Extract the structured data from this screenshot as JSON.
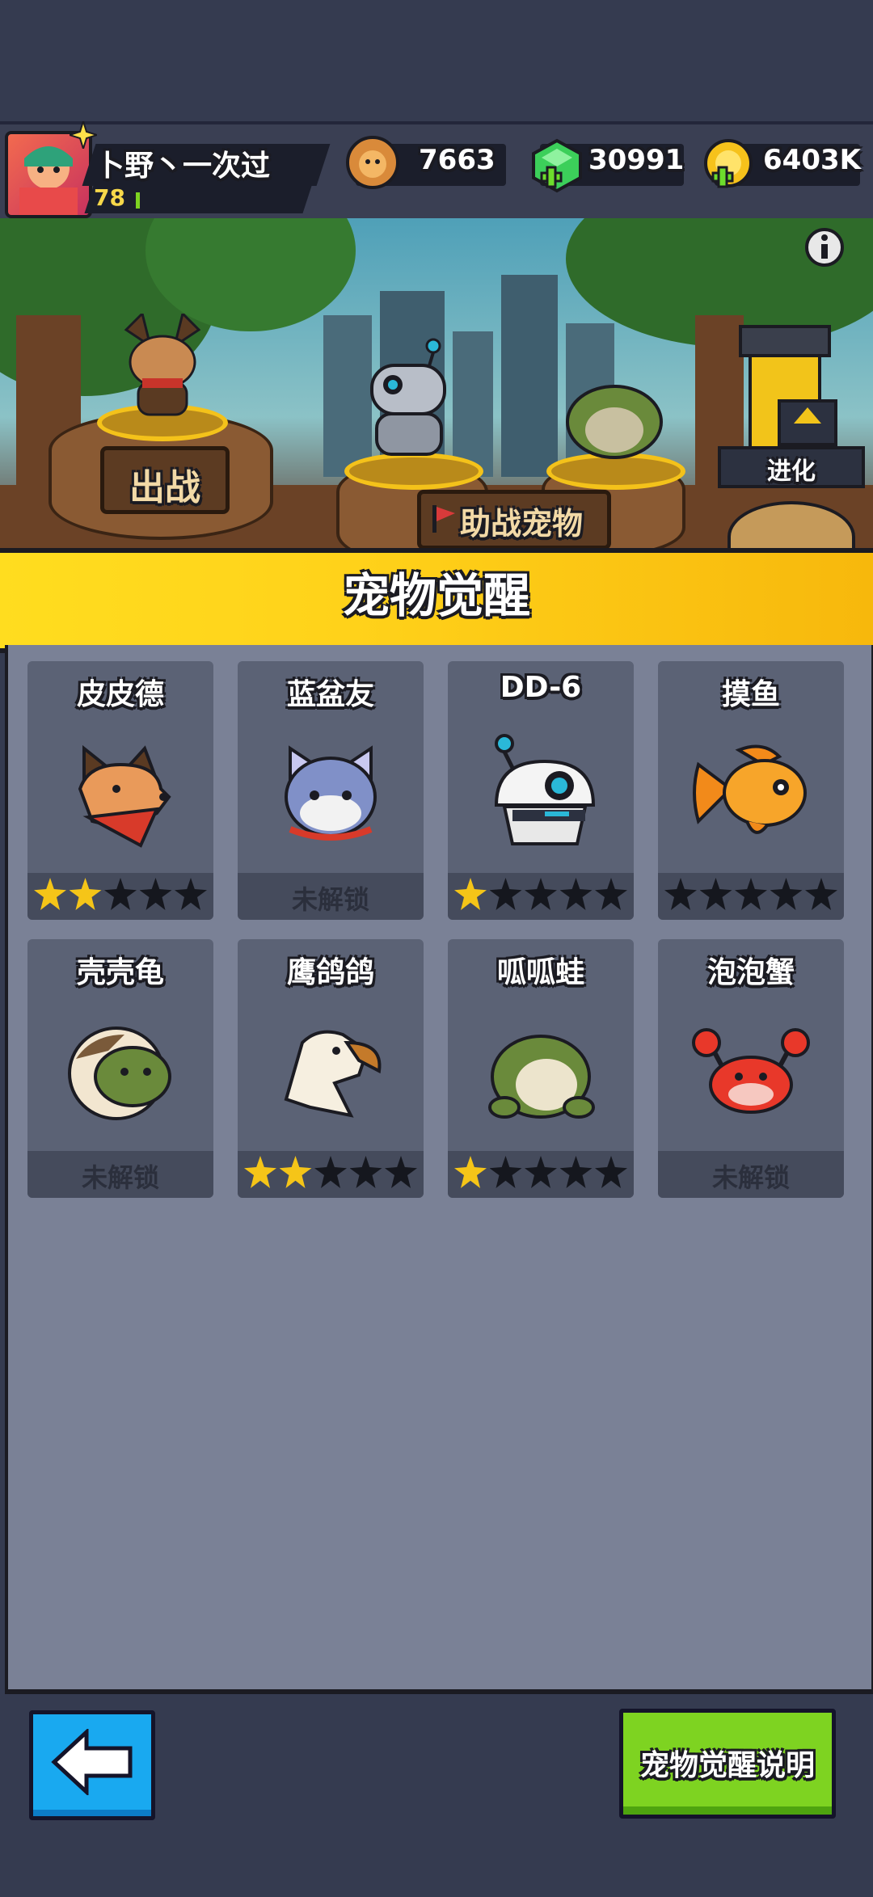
{
  "player": {
    "name": "卜野丶一次过",
    "level": "78"
  },
  "currencies": [
    {
      "icon": "lion-coin-icon",
      "value": "7663"
    },
    {
      "icon": "green-gem-icon",
      "value": "30991"
    },
    {
      "icon": "gold-coin-icon",
      "value": "6403K"
    }
  ],
  "scene": {
    "fight_label": "出战",
    "assist_label": "助战宠物",
    "evolve_label": "进化"
  },
  "banner": {
    "title": "宠物觉醒"
  },
  "locked_label": "未解锁",
  "pets": [
    {
      "name": "皮皮德",
      "icon": "shepherd-dog-icon",
      "stars": 2,
      "locked": false
    },
    {
      "name": "蓝盆友",
      "icon": "blue-cat-icon",
      "stars": 0,
      "locked": true
    },
    {
      "name": "DD-6",
      "icon": "robot-icon",
      "stars": 1,
      "locked": false
    },
    {
      "name": "摸鱼",
      "icon": "goldfish-icon",
      "stars": 0,
      "locked": false
    },
    {
      "name": "壳壳龟",
      "icon": "turtle-icon",
      "stars": 0,
      "locked": true
    },
    {
      "name": "鹰鸽鸽",
      "icon": "eagle-icon",
      "stars": 2,
      "locked": false
    },
    {
      "name": "呱呱蛙",
      "icon": "frog-icon",
      "stars": 1,
      "locked": false
    },
    {
      "name": "泡泡蟹",
      "icon": "crab-icon",
      "stars": 0,
      "locked": true
    }
  ],
  "footer": {
    "help_label": "宠物觉醒说明"
  },
  "colors": {
    "banner": "#ffd21a",
    "star_filled": "#f5c518",
    "back_button": "#19a9f0",
    "help_button": "#7ed321"
  }
}
